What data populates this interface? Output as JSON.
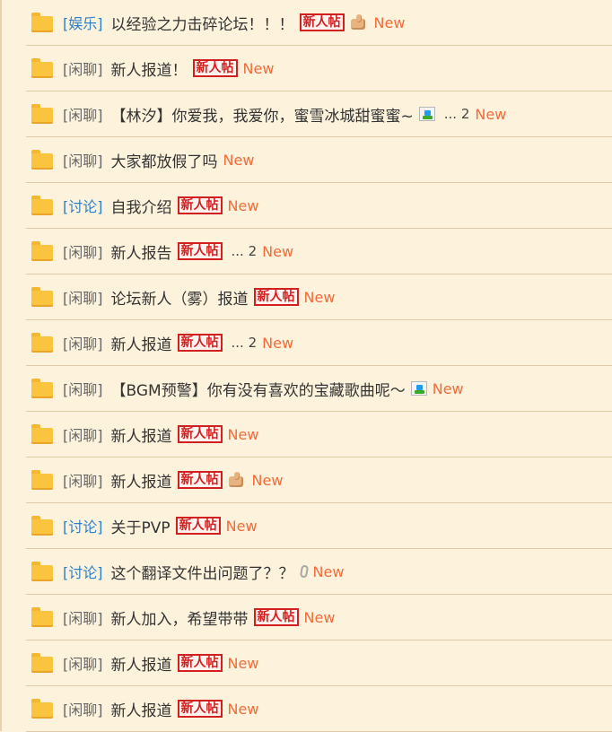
{
  "threads": [
    {
      "category": "[娱乐]",
      "category_style": "blue",
      "title": "以经验之力击碎论坛！！！",
      "badge": "新人帖",
      "thumb": true,
      "image": false,
      "pages": "",
      "clip": false,
      "new": "New"
    },
    {
      "category": "[闲聊]",
      "category_style": "gray",
      "title": "新人报道！",
      "badge": "新人帖",
      "thumb": false,
      "image": false,
      "pages": "",
      "clip": false,
      "new": "New"
    },
    {
      "category": "[闲聊]",
      "category_style": "gray",
      "title": "【林汐】你爱我，我爱你，蜜雪冰城甜蜜蜜~",
      "badge": "",
      "thumb": false,
      "image": true,
      "pages": "... 2",
      "clip": false,
      "new": "New"
    },
    {
      "category": "[闲聊]",
      "category_style": "gray",
      "title": "大家都放假了吗",
      "badge": "",
      "thumb": false,
      "image": false,
      "pages": "",
      "clip": false,
      "new": "New"
    },
    {
      "category": "[讨论]",
      "category_style": "blue",
      "title": "自我介绍",
      "badge": "新人帖",
      "thumb": false,
      "image": false,
      "pages": "",
      "clip": false,
      "new": "New"
    },
    {
      "category": "[闲聊]",
      "category_style": "gray",
      "title": "新人报告",
      "badge": "新人帖",
      "thumb": false,
      "image": false,
      "pages": "... 2",
      "clip": false,
      "new": "New"
    },
    {
      "category": "[闲聊]",
      "category_style": "gray",
      "title": "论坛新人（雾）报道",
      "badge": "新人帖",
      "thumb": false,
      "image": false,
      "pages": "",
      "clip": false,
      "new": "New"
    },
    {
      "category": "[闲聊]",
      "category_style": "gray",
      "title": "新人报道",
      "badge": "新人帖",
      "thumb": false,
      "image": false,
      "pages": "... 2",
      "clip": false,
      "new": "New"
    },
    {
      "category": "[闲聊]",
      "category_style": "gray",
      "title": "【BGM预警】你有没有喜欢的宝藏歌曲呢～",
      "badge": "",
      "thumb": false,
      "image": true,
      "pages": "",
      "clip": false,
      "new": "New"
    },
    {
      "category": "[闲聊]",
      "category_style": "gray",
      "title": "新人报道",
      "badge": "新人帖",
      "thumb": false,
      "image": false,
      "pages": "",
      "clip": false,
      "new": "New"
    },
    {
      "category": "[闲聊]",
      "category_style": "gray",
      "title": "新人报道",
      "badge": "新人帖",
      "thumb": true,
      "image": false,
      "pages": "",
      "clip": false,
      "new": "New"
    },
    {
      "category": "[讨论]",
      "category_style": "blue",
      "title": "关于PVP",
      "badge": "新人帖",
      "thumb": false,
      "image": false,
      "pages": "",
      "clip": false,
      "new": "New"
    },
    {
      "category": "[讨论]",
      "category_style": "blue",
      "title": "这个翻译文件出问题了？？",
      "badge": "",
      "thumb": false,
      "image": false,
      "pages": "",
      "clip": true,
      "new": "New"
    },
    {
      "category": "[闲聊]",
      "category_style": "gray",
      "title": "新人加入，希望带带",
      "badge": "新人帖",
      "thumb": false,
      "image": false,
      "pages": "",
      "clip": false,
      "new": "New"
    },
    {
      "category": "[闲聊]",
      "category_style": "gray",
      "title": "新人报道",
      "badge": "新人帖",
      "thumb": false,
      "image": false,
      "pages": "",
      "clip": false,
      "new": "New"
    },
    {
      "category": "[闲聊]",
      "category_style": "gray",
      "title": "新人报道",
      "badge": "新人帖",
      "thumb": false,
      "image": false,
      "pages": "",
      "clip": false,
      "new": "New"
    }
  ],
  "colors": {
    "background": "#fdf3dc",
    "divider": "#dccba4",
    "category_blue": "#2f7ec8",
    "category_gray": "#666666",
    "title": "#333333",
    "badge_red": "#d41f1f",
    "new_orange": "#f26b3a",
    "folder_yellow": "#fbc43f"
  },
  "icons": {
    "folder": "folder-icon",
    "thumb": "thumbs-up-icon",
    "image": "image-icon",
    "clip": "attachment-icon"
  }
}
